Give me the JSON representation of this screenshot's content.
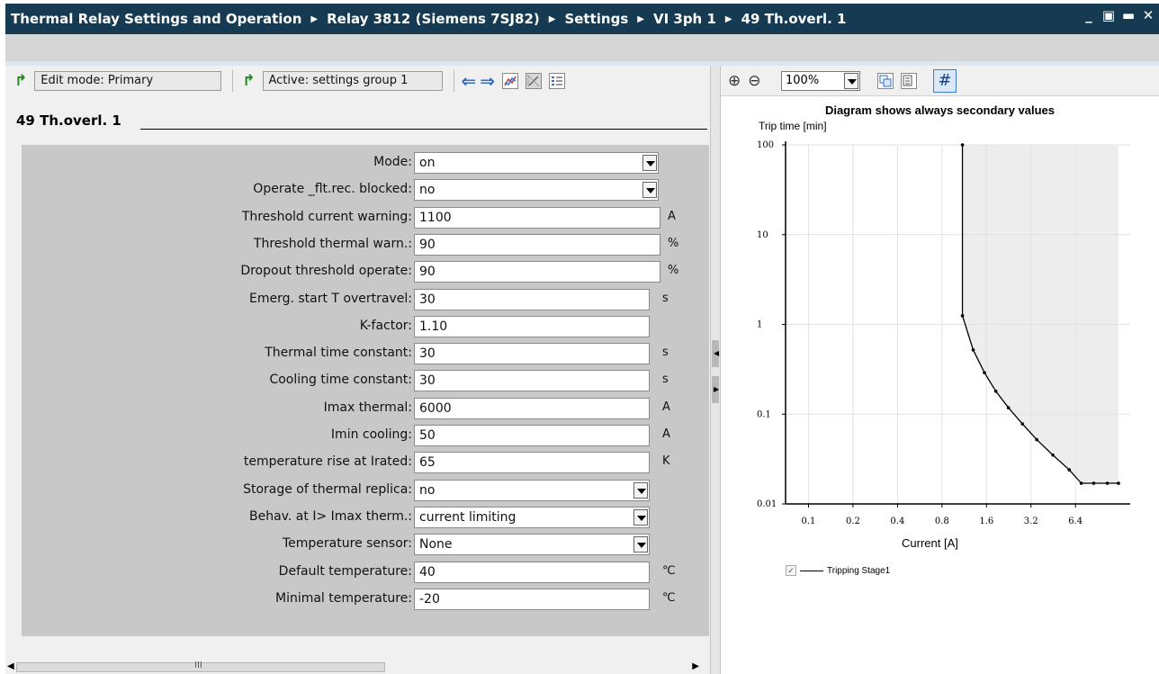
{
  "titlebar": {
    "crumbs": [
      "Thermal Relay Settings and Operation",
      "Relay 3812 (Siemens 7SJ82)",
      "Settings",
      "VI 3ph 1",
      "49 Th.overl. 1"
    ],
    "controls": [
      "_",
      "▣",
      "▬",
      "✕"
    ]
  },
  "toolbar": {
    "edit_mode": "Edit mode: Primary",
    "active_group": "Active: settings group 1"
  },
  "section": {
    "title": "49 Th.overl. 1"
  },
  "form": {
    "rows": [
      {
        "label": "Mode:",
        "value": "on",
        "type": "dropdown",
        "unit": ""
      },
      {
        "label": "Operate _flt.rec. blocked:",
        "value": "no",
        "type": "dropdown",
        "unit": ""
      },
      {
        "label": "Threshold current warning:",
        "value": "1100",
        "type": "text",
        "unit": "A"
      },
      {
        "label": "Threshold thermal warn.:",
        "value": "90",
        "type": "text",
        "unit": "%"
      },
      {
        "label": "Dropout threshold operate:",
        "value": "90",
        "type": "text",
        "unit": "%"
      },
      {
        "label": "Emerg. start T overtravel:",
        "value": "30",
        "type": "text",
        "unit": "s"
      },
      {
        "label": "K-factor:",
        "value": "1.10",
        "type": "text",
        "unit": ""
      },
      {
        "label": "Thermal time constant:",
        "value": "30",
        "type": "text",
        "unit": "s"
      },
      {
        "label": "Cooling time constant:",
        "value": "30",
        "type": "text",
        "unit": "s"
      },
      {
        "label": "Imax thermal:",
        "value": "6000",
        "type": "text",
        "unit": "A"
      },
      {
        "label": "Imin cooling:",
        "value": "50",
        "type": "text",
        "unit": "A"
      },
      {
        "label": "temperature rise at Irated:",
        "value": "65",
        "type": "text",
        "unit": "K"
      },
      {
        "label": "Storage of thermal replica:",
        "value": "no",
        "type": "dropdown",
        "unit": ""
      },
      {
        "label": "Behav. at I> Imax therm.:",
        "value": "current limiting",
        "type": "dropdown",
        "unit": ""
      },
      {
        "label": "Temperature sensor:",
        "value": "None",
        "type": "dropdown",
        "unit": ""
      },
      {
        "label": "Default temperature:",
        "value": "40",
        "type": "text",
        "unit": "℃"
      },
      {
        "label": "Minimal temperature:",
        "value": "-20",
        "type": "text",
        "unit": "℃"
      }
    ]
  },
  "scrollbar": {
    "grip": "III"
  },
  "diagram_toolbar": {
    "zoom": "100%"
  },
  "chart_data": {
    "type": "line",
    "title": "Diagram shows always secondary values",
    "ylabel": "Trip time [min]",
    "xlabel": "Current [A]",
    "x_ticks": [
      "0.1",
      "0.2",
      "0.4",
      "0.8",
      "1.6",
      "3.2",
      "6.4"
    ],
    "y_ticks": [
      "100",
      "10",
      "1",
      "0.1",
      "0.01"
    ],
    "x_scale": "log2",
    "y_scale": "log10",
    "xlim": [
      0.07,
      15
    ],
    "ylim": [
      0.01,
      100
    ],
    "grid": true,
    "legend_position": "bottom-left",
    "series": [
      {
        "name": "Tripping Stage1",
        "x": [
          1.1,
          1.1,
          1.3,
          1.55,
          1.85,
          2.25,
          2.8,
          3.5,
          4.5,
          5.8,
          7.0,
          8.5,
          10.5,
          12.5
        ],
        "y": [
          100,
          1.25,
          0.52,
          0.29,
          0.18,
          0.118,
          0.078,
          0.052,
          0.035,
          0.024,
          0.017,
          0.017,
          0.017,
          0.017
        ]
      }
    ]
  }
}
